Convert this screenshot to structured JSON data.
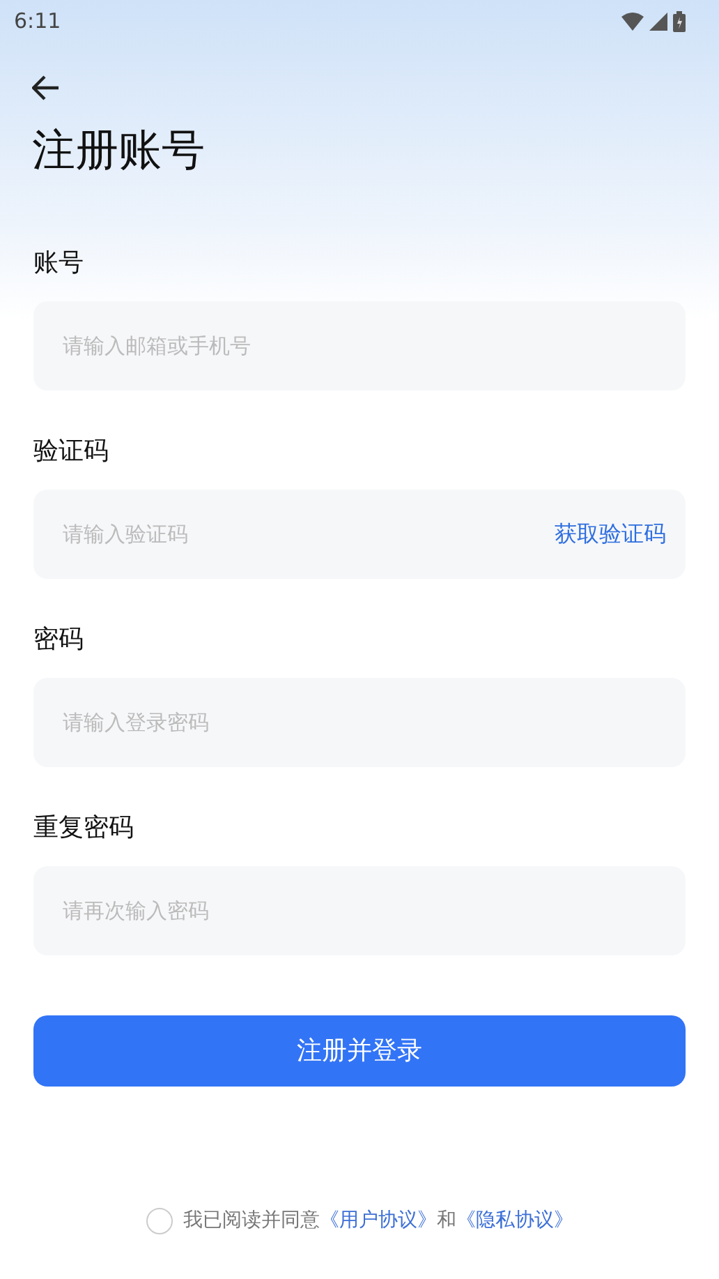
{
  "status_bar": {
    "time": "6:11"
  },
  "title": "注册账号",
  "fields": [
    {
      "label": "账号",
      "placeholder": "请输入邮箱或手机号"
    },
    {
      "label": "验证码",
      "placeholder": "请输入验证码",
      "action": "获取验证码"
    },
    {
      "label": "密码",
      "placeholder": "请输入登录密码"
    },
    {
      "label": "重复密码",
      "placeholder": "请再次输入密码"
    }
  ],
  "submit": "注册并登录",
  "agreement": {
    "checked": false,
    "text": "我已阅读并同意",
    "links": [
      "《用户协议》",
      "《隐私协议》"
    ],
    "joiner": "和"
  }
}
